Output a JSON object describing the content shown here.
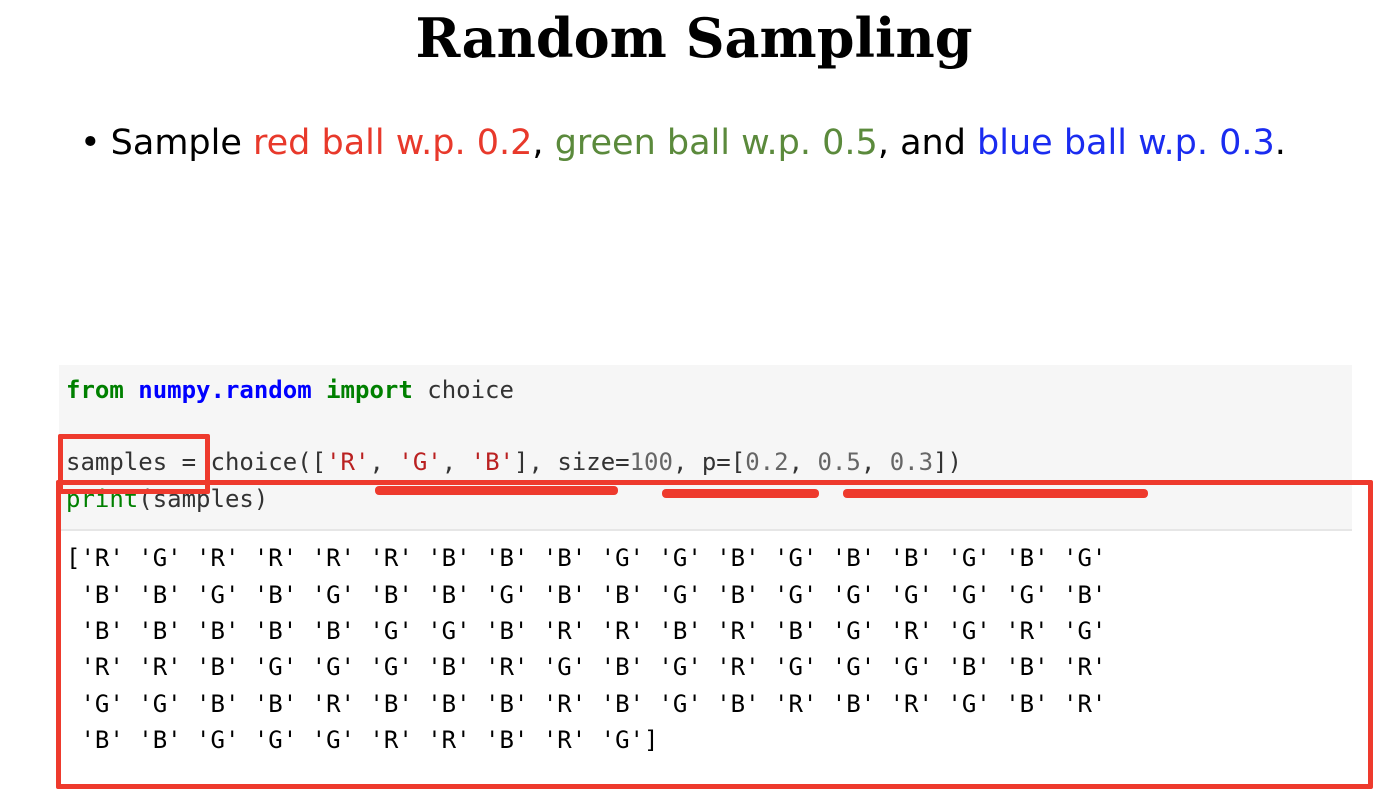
{
  "slide": {
    "title": "Random Sampling",
    "bullet": {
      "prefix": "Sample ",
      "red_part": "red ball w.p. 0.2",
      "sep1": ", ",
      "green_part": "green ball w.p. 0.5",
      "sep2": ", and ",
      "blue_part": "blue ball w.p. 0.3",
      "suffix": ".",
      "colors": {
        "red": "#e8392b",
        "green": "#5b8a3c",
        "blue": "#1a2cf0"
      }
    }
  },
  "code": {
    "line1": {
      "kw_from": "from",
      "module": "numpy.random",
      "kw_import": "import",
      "name": " choice"
    },
    "line2": {
      "var": "samples",
      "eq": " = choice([",
      "s1": "'R'",
      "c1": ", ",
      "s2": "'G'",
      "c2": ", ",
      "s3": "'B'",
      "mid": "], size=",
      "n1": "100",
      "mid2": ", p=[",
      "n2": "0.2",
      "c3": ", ",
      "n3": "0.5",
      "c4": ", ",
      "n4": "0.3",
      "end": "])"
    },
    "line3": {
      "fn": "print",
      "args": "(samples)"
    }
  },
  "output": {
    "lines": [
      "['R' 'G' 'R' 'R' 'R' 'R' 'B' 'B' 'B' 'G' 'G' 'B' 'G' 'B' 'B' 'G' 'B' 'G'",
      " 'B' 'B' 'G' 'B' 'G' 'B' 'B' 'G' 'B' 'B' 'G' 'B' 'G' 'G' 'G' 'G' 'G' 'B'",
      " 'B' 'B' 'B' 'B' 'B' 'G' 'G' 'B' 'R' 'R' 'B' 'R' 'B' 'G' 'R' 'G' 'R' 'G'",
      " 'R' 'R' 'B' 'G' 'G' 'G' 'B' 'R' 'G' 'B' 'G' 'R' 'G' 'G' 'G' 'B' 'B' 'R'",
      " 'G' 'G' 'B' 'B' 'R' 'B' 'B' 'B' 'R' 'B' 'G' 'B' 'R' 'B' 'R' 'G' 'B' 'R'",
      " 'B' 'B' 'G' 'G' 'G' 'R' 'R' 'B' 'R' 'G']"
    ]
  },
  "annotations": {
    "highlight_color": "#ee3a2d"
  }
}
